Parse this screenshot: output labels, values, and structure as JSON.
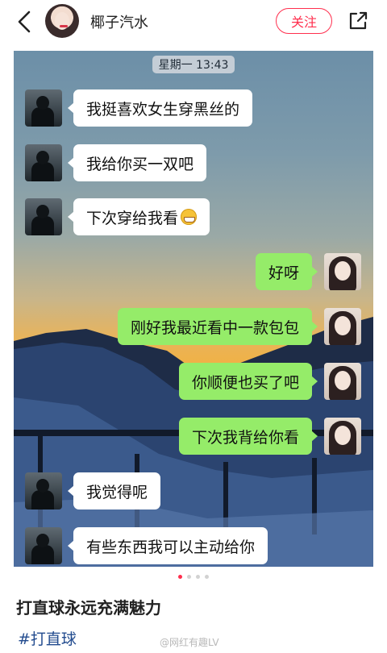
{
  "header": {
    "author_name": "椰子汽水",
    "follow_label": "关注",
    "icons": {
      "back": "chevron-left-icon",
      "share": "share-out-icon"
    }
  },
  "chat": {
    "timestamp": "星期一 13:43",
    "messages": [
      {
        "side": "left",
        "text": "我挺喜欢女生穿黑丝的"
      },
      {
        "side": "left",
        "text": "我给你买一双吧"
      },
      {
        "side": "left",
        "text": "下次穿给我看",
        "emoji": "grinning-face-icon"
      },
      {
        "side": "right",
        "text": "好呀"
      },
      {
        "side": "right",
        "text": "刚好我最近看中一款包包"
      },
      {
        "side": "right",
        "text": "你顺便也买了吧"
      },
      {
        "side": "right",
        "text": "下次我背给你看"
      },
      {
        "side": "left",
        "text": "我觉得呢"
      },
      {
        "side": "left",
        "text": "有些东西我可以主动给你"
      }
    ]
  },
  "pager": {
    "total": 4,
    "active_index": 1
  },
  "post": {
    "title": "打直球永远充满魅力",
    "hashtag": "#打直球"
  },
  "watermark": "@网红有趣LV",
  "colors": {
    "accent": "#ff2e4d",
    "bubble_right": "#95ec69",
    "bubble_left": "#ffffff",
    "hashtag": "#234c8f"
  }
}
